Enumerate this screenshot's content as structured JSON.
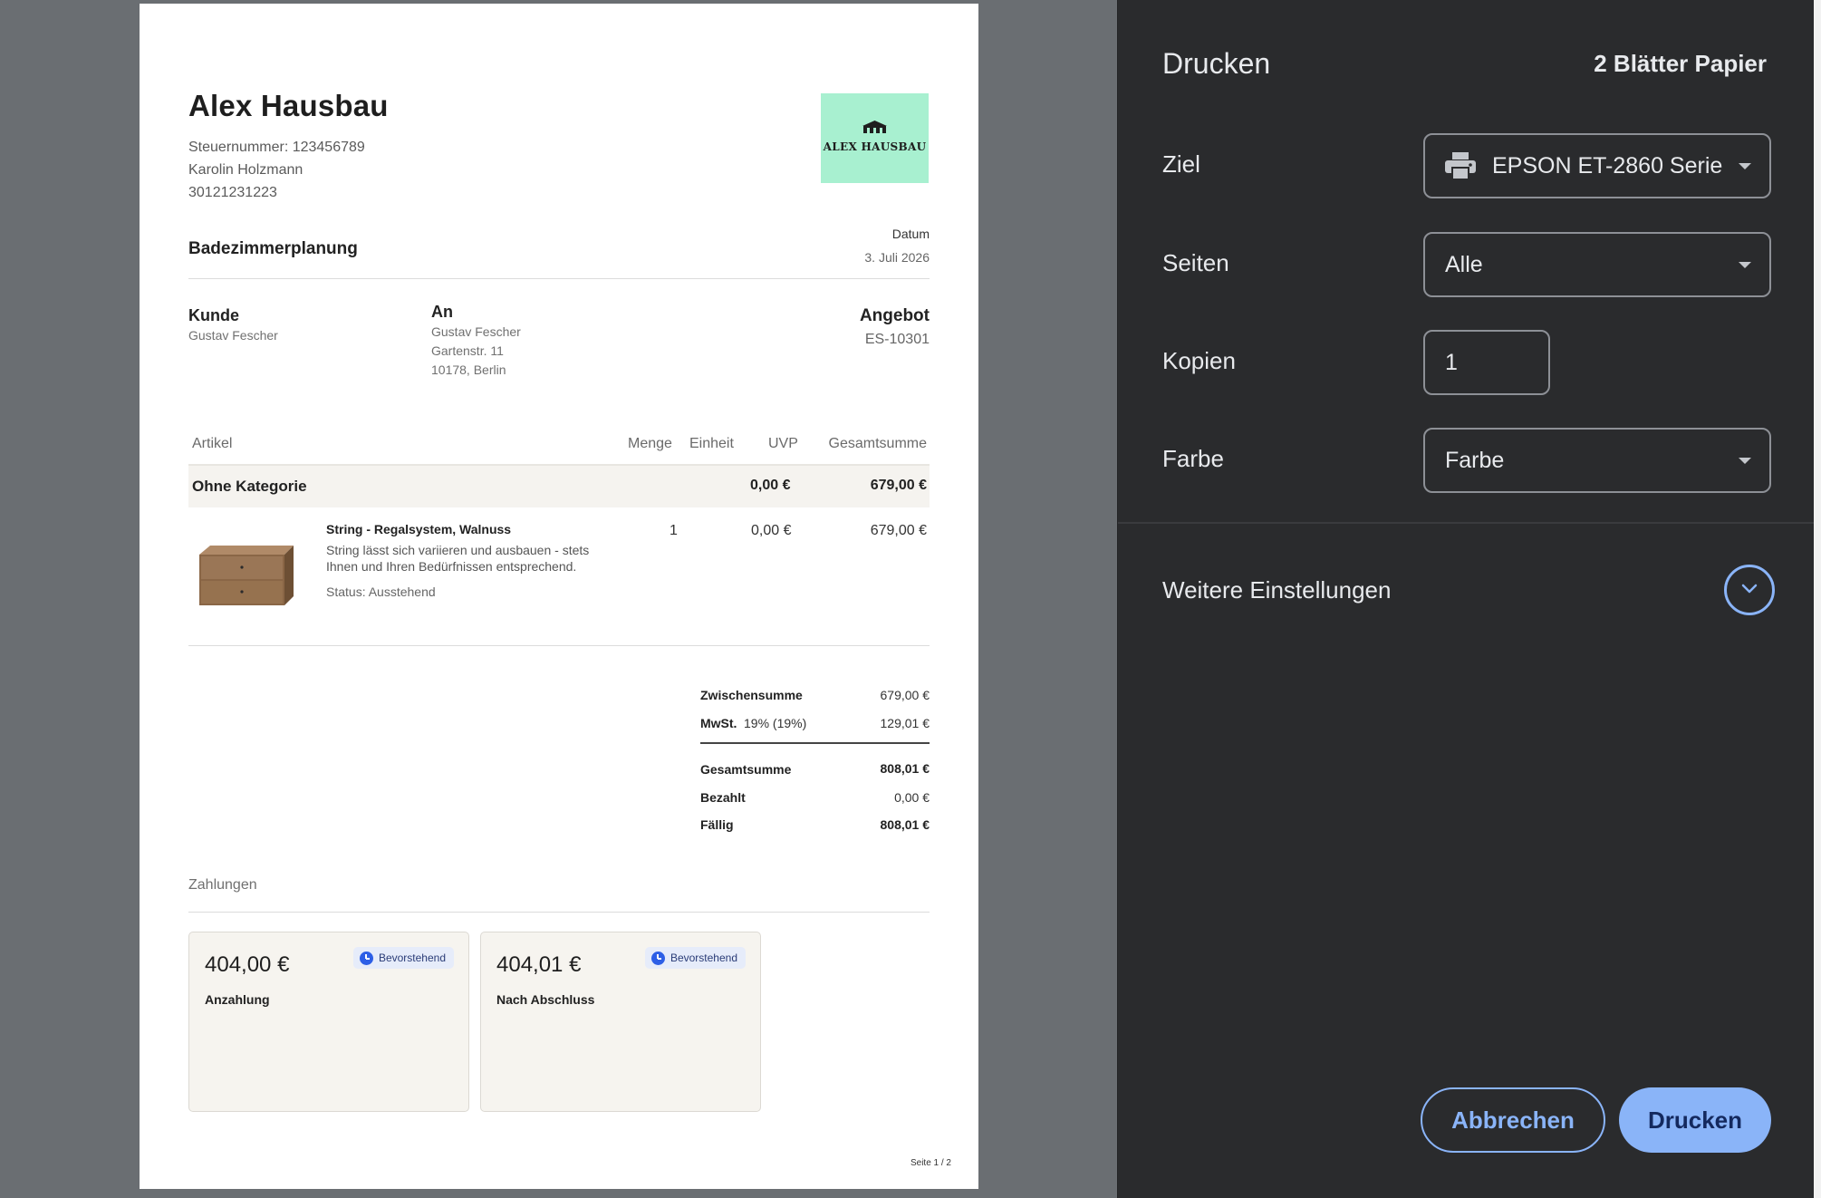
{
  "document": {
    "company": "Alex Hausbau",
    "tax_number": "Steuernummer: 123456789",
    "contact_name": "Karolin Holzmann",
    "contact_phone": "30121231223",
    "logo_text": "ALEX HAUSBAU",
    "project": "Badezimmerplanung",
    "date_label": "Datum",
    "date_value": "3. Juli 2026",
    "customer_label": "Kunde",
    "customer_name": "Gustav Fescher",
    "to_label": "An",
    "to_name": "Gustav Fescher",
    "to_street": "Gartenstr. 11",
    "to_city": "10178, Berlin",
    "offer_label": "Angebot",
    "offer_number": "ES-10301",
    "table": {
      "headers": {
        "article": "Artikel",
        "qty": "Menge",
        "unit": "Einheit",
        "uvp": "UVP",
        "total": "Gesamtsumme"
      },
      "category": {
        "name": "Ohne Kategorie",
        "uvp": "0,00 €",
        "total": "679,00 €"
      },
      "item": {
        "name": "String - Regalsystem, Walnuss",
        "description": "String lässt sich variieren und ausbauen - stets Ihnen und Ihren Bedürfnissen entsprechend.",
        "status": "Status: Ausstehend",
        "qty": "1",
        "uvp": "0,00 €",
        "total": "679,00 €"
      }
    },
    "totals": {
      "subtotal_label": "Zwischensumme",
      "subtotal": "679,00 €",
      "vat_label": "MwSt.",
      "vat_rate": "19% (19%)",
      "vat": "129,01 €",
      "grand_label": "Gesamtsumme",
      "grand": "808,01 €",
      "paid_label": "Bezahlt",
      "paid": "0,00 €",
      "due_label": "Fällig",
      "due": "808,01 €"
    },
    "payments_title": "Zahlungen",
    "payments": [
      {
        "amount": "404,00 €",
        "label": "Anzahlung",
        "status": "Bevorstehend"
      },
      {
        "amount": "404,01 €",
        "label": "Nach Abschluss",
        "status": "Bevorstehend"
      }
    ],
    "page_number": "Seite 1 / 2"
  },
  "dialog": {
    "title": "Drucken",
    "sheets": "2 Blätter Papier",
    "destination_label": "Ziel",
    "destination_value": "EPSON ET-2860 Serie",
    "pages_label": "Seiten",
    "pages_value": "Alle",
    "copies_label": "Kopien",
    "copies_value": "1",
    "color_label": "Farbe",
    "color_value": "Farbe",
    "more_settings": "Weitere Einstellungen",
    "cancel": "Abbrechen",
    "print": "Drucken",
    "accent_color": "#8ab4f8"
  }
}
